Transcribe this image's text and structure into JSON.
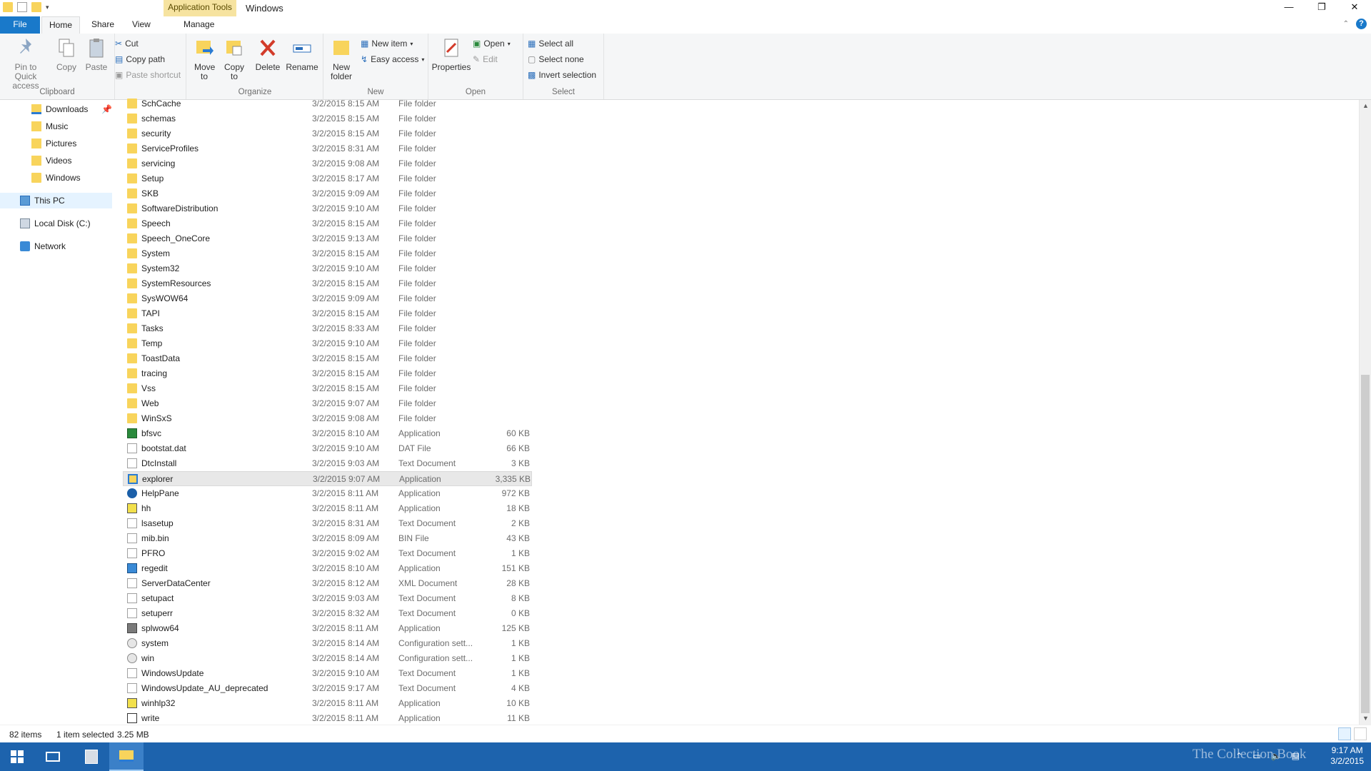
{
  "window": {
    "context_tab": "Application Tools",
    "title": "Windows",
    "controls": {
      "minimize": "—",
      "restore": "❐",
      "close": "✕"
    }
  },
  "ribbon_tabs": {
    "file": "File",
    "home": "Home",
    "share": "Share",
    "view": "View",
    "manage": "Manage"
  },
  "ribbon": {
    "clipboard": {
      "pin": "Pin to Quick access",
      "copy": "Copy",
      "paste": "Paste",
      "cut": "Cut",
      "copy_path": "Copy path",
      "paste_shortcut": "Paste shortcut",
      "label": "Clipboard"
    },
    "organize": {
      "move_to": "Move to",
      "copy_to": "Copy to",
      "delete": "Delete",
      "rename": "Rename",
      "label": "Organize"
    },
    "new": {
      "new_folder": "New folder",
      "new_item": "New item",
      "easy_access": "Easy access",
      "label": "New"
    },
    "open": {
      "properties": "Properties",
      "open": "Open",
      "edit": "Edit",
      "label": "Open"
    },
    "select": {
      "select_all": "Select all",
      "select_none": "Select none",
      "invert": "Invert selection",
      "label": "Select"
    }
  },
  "nav": {
    "items": [
      {
        "label": "Downloads",
        "icon": "downloads-icon"
      },
      {
        "label": "Music",
        "icon": "music-icon"
      },
      {
        "label": "Pictures",
        "icon": "pictures-icon"
      },
      {
        "label": "Videos",
        "icon": "videos-icon"
      },
      {
        "label": "Windows",
        "icon": "folder-icon"
      },
      {
        "label": "This PC",
        "icon": "computer-icon"
      },
      {
        "label": "Local Disk (C:)",
        "icon": "drive-icon"
      },
      {
        "label": "Network",
        "icon": "network-icon"
      }
    ]
  },
  "files": [
    {
      "name": "SchCache",
      "date": "3/2/2015 8:15 AM",
      "type": "File folder",
      "size": "",
      "icon": "folder"
    },
    {
      "name": "schemas",
      "date": "3/2/2015 8:15 AM",
      "type": "File folder",
      "size": "",
      "icon": "folder"
    },
    {
      "name": "security",
      "date": "3/2/2015 8:15 AM",
      "type": "File folder",
      "size": "",
      "icon": "folder"
    },
    {
      "name": "ServiceProfiles",
      "date": "3/2/2015 8:31 AM",
      "type": "File folder",
      "size": "",
      "icon": "folder"
    },
    {
      "name": "servicing",
      "date": "3/2/2015 9:08 AM",
      "type": "File folder",
      "size": "",
      "icon": "folder"
    },
    {
      "name": "Setup",
      "date": "3/2/2015 8:17 AM",
      "type": "File folder",
      "size": "",
      "icon": "folder"
    },
    {
      "name": "SKB",
      "date": "3/2/2015 9:09 AM",
      "type": "File folder",
      "size": "",
      "icon": "folder"
    },
    {
      "name": "SoftwareDistribution",
      "date": "3/2/2015 9:10 AM",
      "type": "File folder",
      "size": "",
      "icon": "folder"
    },
    {
      "name": "Speech",
      "date": "3/2/2015 8:15 AM",
      "type": "File folder",
      "size": "",
      "icon": "folder"
    },
    {
      "name": "Speech_OneCore",
      "date": "3/2/2015 9:13 AM",
      "type": "File folder",
      "size": "",
      "icon": "folder"
    },
    {
      "name": "System",
      "date": "3/2/2015 8:15 AM",
      "type": "File folder",
      "size": "",
      "icon": "folder"
    },
    {
      "name": "System32",
      "date": "3/2/2015 9:10 AM",
      "type": "File folder",
      "size": "",
      "icon": "folder"
    },
    {
      "name": "SystemResources",
      "date": "3/2/2015 8:15 AM",
      "type": "File folder",
      "size": "",
      "icon": "folder"
    },
    {
      "name": "SysWOW64",
      "date": "3/2/2015 9:09 AM",
      "type": "File folder",
      "size": "",
      "icon": "folder"
    },
    {
      "name": "TAPI",
      "date": "3/2/2015 8:15 AM",
      "type": "File folder",
      "size": "",
      "icon": "folder"
    },
    {
      "name": "Tasks",
      "date": "3/2/2015 8:33 AM",
      "type": "File folder",
      "size": "",
      "icon": "folder"
    },
    {
      "name": "Temp",
      "date": "3/2/2015 9:10 AM",
      "type": "File folder",
      "size": "",
      "icon": "folder"
    },
    {
      "name": "ToastData",
      "date": "3/2/2015 8:15 AM",
      "type": "File folder",
      "size": "",
      "icon": "folder"
    },
    {
      "name": "tracing",
      "date": "3/2/2015 8:15 AM",
      "type": "File folder",
      "size": "",
      "icon": "folder"
    },
    {
      "name": "Vss",
      "date": "3/2/2015 8:15 AM",
      "type": "File folder",
      "size": "",
      "icon": "folder"
    },
    {
      "name": "Web",
      "date": "3/2/2015 9:07 AM",
      "type": "File folder",
      "size": "",
      "icon": "folder"
    },
    {
      "name": "WinSxS",
      "date": "3/2/2015 9:08 AM",
      "type": "File folder",
      "size": "",
      "icon": "folder"
    },
    {
      "name": "bfsvc",
      "date": "3/2/2015 8:10 AM",
      "type": "Application",
      "size": "60 KB",
      "icon": "app"
    },
    {
      "name": "bootstat.dat",
      "date": "3/2/2015 9:10 AM",
      "type": "DAT File",
      "size": "66 KB",
      "icon": "file"
    },
    {
      "name": "DtcInstall",
      "date": "3/2/2015 9:03 AM",
      "type": "Text Document",
      "size": "3 KB",
      "icon": "file"
    },
    {
      "name": "explorer",
      "date": "3/2/2015 9:07 AM",
      "type": "Application",
      "size": "3,335 KB",
      "icon": "explorer",
      "selected": true
    },
    {
      "name": "HelpPane",
      "date": "3/2/2015 8:11 AM",
      "type": "Application",
      "size": "972 KB",
      "icon": "help"
    },
    {
      "name": "hh",
      "date": "3/2/2015 8:11 AM",
      "type": "Application",
      "size": "18 KB",
      "icon": "hh"
    },
    {
      "name": "lsasetup",
      "date": "3/2/2015 8:31 AM",
      "type": "Text Document",
      "size": "2 KB",
      "icon": "file"
    },
    {
      "name": "mib.bin",
      "date": "3/2/2015 8:09 AM",
      "type": "BIN File",
      "size": "43 KB",
      "icon": "file"
    },
    {
      "name": "PFRO",
      "date": "3/2/2015 9:02 AM",
      "type": "Text Document",
      "size": "1 KB",
      "icon": "file"
    },
    {
      "name": "regedit",
      "date": "3/2/2015 8:10 AM",
      "type": "Application",
      "size": "151 KB",
      "icon": "reg"
    },
    {
      "name": "ServerDataCenter",
      "date": "3/2/2015 8:12 AM",
      "type": "XML Document",
      "size": "28 KB",
      "icon": "file"
    },
    {
      "name": "setupact",
      "date": "3/2/2015 9:03 AM",
      "type": "Text Document",
      "size": "8 KB",
      "icon": "file"
    },
    {
      "name": "setuperr",
      "date": "3/2/2015 8:32 AM",
      "type": "Text Document",
      "size": "0 KB",
      "icon": "file"
    },
    {
      "name": "splwow64",
      "date": "3/2/2015 8:11 AM",
      "type": "Application",
      "size": "125 KB",
      "icon": "print"
    },
    {
      "name": "system",
      "date": "3/2/2015 8:14 AM",
      "type": "Configuration sett...",
      "size": "1 KB",
      "icon": "cfg"
    },
    {
      "name": "win",
      "date": "3/2/2015 8:14 AM",
      "type": "Configuration sett...",
      "size": "1 KB",
      "icon": "cfg"
    },
    {
      "name": "WindowsUpdate",
      "date": "3/2/2015 9:10 AM",
      "type": "Text Document",
      "size": "1 KB",
      "icon": "file"
    },
    {
      "name": "WindowsUpdate_AU_deprecated",
      "date": "3/2/2015 9:17 AM",
      "type": "Text Document",
      "size": "4 KB",
      "icon": "file"
    },
    {
      "name": "winhlp32",
      "date": "3/2/2015 8:11 AM",
      "type": "Application",
      "size": "10 KB",
      "icon": "hh"
    },
    {
      "name": "write",
      "date": "3/2/2015 8:11 AM",
      "type": "Application",
      "size": "11 KB",
      "icon": "write"
    }
  ],
  "status": {
    "count": "82 items",
    "selection": "1 item selected",
    "size": "3.25 MB"
  },
  "taskbar": {
    "watermark": "The Collection Book",
    "time": "9:17 AM",
    "date": "3/2/2015"
  },
  "colors": {
    "accent": "#1979ca",
    "taskbar": "#1d63ad",
    "folder": "#f8d45c",
    "context_tab": "#f6e3a0"
  }
}
